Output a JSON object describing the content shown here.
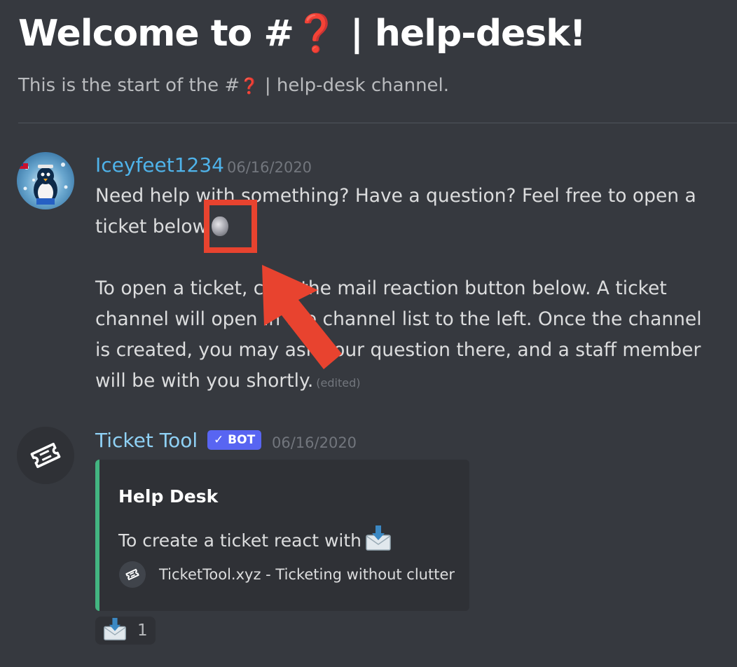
{
  "header": {
    "title_prefix": "Welcome to #",
    "title_emoji": "❓",
    "title_suffix": " | help-desk!",
    "subtitle_prefix": "This is the start of the #",
    "subtitle_emoji": "❓",
    "subtitle_suffix": " | help-desk channel."
  },
  "messages": [
    {
      "author": "Iceyfeet1234",
      "timestamp": "06/16/2020",
      "avatar_icon": "penguin-avatar-icon",
      "line1": "Need help with something? Have a question? Feel free to open a ticket below",
      "line2": "To open a ticket, click the mail reaction button below. A ticket channel will open in the channel list to the left. Once the channel is created, you may ask your question there, and a staff member will be with you shortly.",
      "edited": "(edited)"
    },
    {
      "author": "Ticket Tool",
      "bot_tag": "✓ BOT",
      "timestamp": "06/16/2020",
      "avatar_icon": "ticket-icon",
      "embed": {
        "title": "Help Desk",
        "description": "To create a ticket react with",
        "footer": "TicketTool.xyz - Ticketing without clutter",
        "accent_color": "#43b581"
      },
      "reaction": {
        "emoji": "inbox-envelope-icon",
        "count": "1"
      }
    }
  ],
  "annotation": {
    "highlight_color": "#e8432f"
  },
  "colors": {
    "background": "#36393f",
    "embed_bg": "#2f3136",
    "username_1": "#4fb3ea",
    "username_2": "#8fd1f5",
    "bot_tag": "#5865f2"
  }
}
